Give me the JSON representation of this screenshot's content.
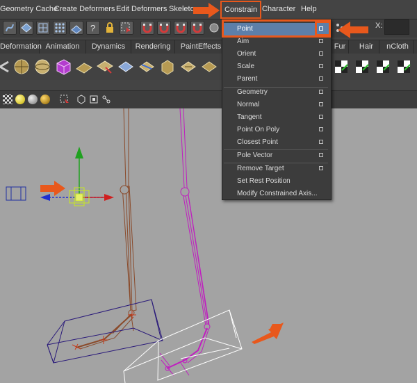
{
  "menubar": {
    "items": [
      "Geometry Cache",
      "Create Deformers",
      "Edit Deformers",
      "Skeleto",
      "Constrain",
      "Character",
      "Help"
    ]
  },
  "toolbar": {
    "x_label": "X:"
  },
  "shelf_tabs": [
    "Deformation",
    "Animation",
    "Dynamics",
    "Rendering",
    "PaintEffects",
    "Fur",
    "Hair",
    "nCloth"
  ],
  "constrain_menu": {
    "items": [
      {
        "label": "Point",
        "option": true,
        "highlighted": true
      },
      {
        "label": "Aim",
        "option": true
      },
      {
        "label": "Orient",
        "option": true
      },
      {
        "label": "Scale",
        "option": true
      },
      {
        "label": "Parent",
        "option": true
      },
      {
        "label": "Geometry",
        "option": true
      },
      {
        "label": "Normal",
        "option": true
      },
      {
        "label": "Tangent",
        "option": true
      },
      {
        "label": "Point On Poly",
        "option": true
      },
      {
        "label": "Closest Point",
        "option": true
      },
      {
        "label": "Pole Vector",
        "option": true
      },
      {
        "label": "Remove Target",
        "option": true
      },
      {
        "label": "Set Rest Position",
        "option": false
      },
      {
        "label": "Modify Constrained Axis...",
        "option": false
      }
    ]
  },
  "colors": {
    "annotation_arrow": "#e8581c",
    "menu_highlight": "#5d7fa9",
    "viewport_bg": "#a3a3a3",
    "left_leg": "#8a4a2a",
    "right_leg": "#c01ec0",
    "left_foot_box": "#2a1a7a",
    "right_foot_box": "#ffffff",
    "manipulator_y": "#1fa11f",
    "manipulator_x": "#d01f1f",
    "manipulator_z": "#1f2fd0",
    "selected_locator": "#c8e81f"
  }
}
